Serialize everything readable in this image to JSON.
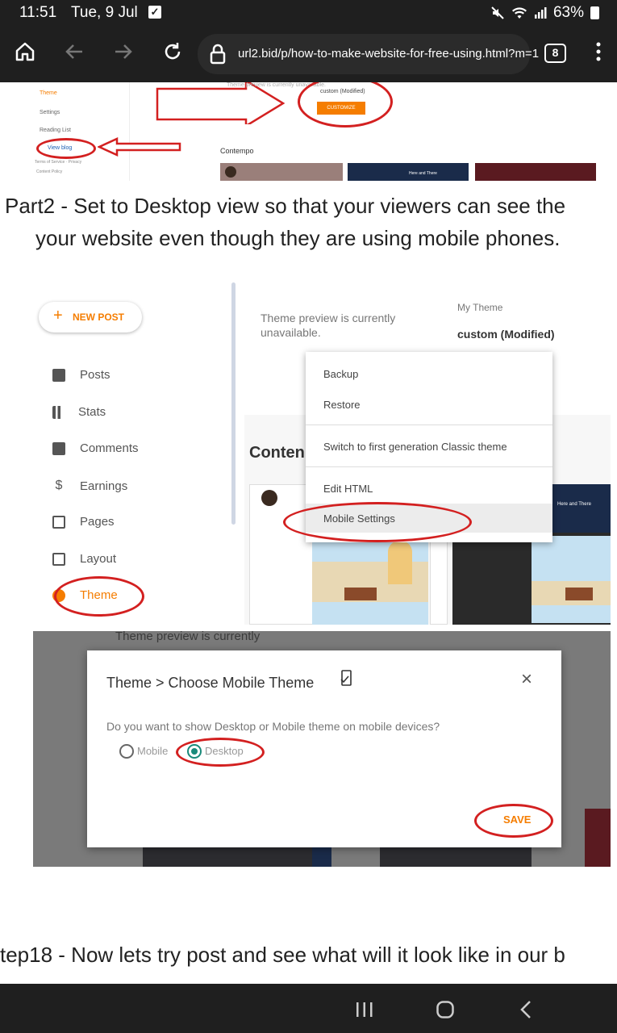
{
  "status_bar": {
    "time": "11:51",
    "date": "Tue, 9 Jul",
    "battery": "63%"
  },
  "browser": {
    "url": "url2.bid/p/how-to-make-website-for-free-using.html?m=1",
    "tab_count": "8"
  },
  "screenshot1": {
    "sidebar": [
      "Theme",
      "Settings",
      "Reading List",
      "View blog"
    ],
    "footer_links": "Terms of Service · Privacy",
    "footer2": "Content Policy",
    "theme_name": "custom (Modified)",
    "customize": "CUSTOMIZE",
    "section": "Contempo",
    "preview_text": "Theme preview is currently unavailable.",
    "thumb_label": "Here and There"
  },
  "caption_part2_line1": "Part2 - Set to Desktop view so that your viewers can see the",
  "caption_part2_line2": "your website even though they are using mobile phones.",
  "screenshot2": {
    "new_post": "NEW POST",
    "sidebar": [
      "Posts",
      "Stats",
      "Comments",
      "Earnings",
      "Pages",
      "Layout",
      "Theme"
    ],
    "preview_text_1": "Theme preview is currently",
    "preview_text_2": "unavailable.",
    "my_theme_label": "My Theme",
    "theme_name": "custom (Modified)",
    "section_label": "Conten",
    "menu": [
      "Backup",
      "Restore",
      "Switch to first generation Classic theme",
      "Edit HTML",
      "Mobile Settings"
    ],
    "thumb_label": "Here and There"
  },
  "screenshot3": {
    "bg_text": "Theme preview is currently",
    "dialog_title": "Theme > Choose Mobile Theme",
    "question": "Do you want to show Desktop or Mobile theme on mobile devices?",
    "option_mobile": "Mobile",
    "option_desktop": "Desktop",
    "save": "SAVE"
  },
  "caption_step18": "tep18 - Now lets try post and see what will it look like in our b",
  "colors": {
    "accent_red": "#d32020",
    "blogger_orange": "#f57d00",
    "teal_radio": "#1a8a7a"
  }
}
